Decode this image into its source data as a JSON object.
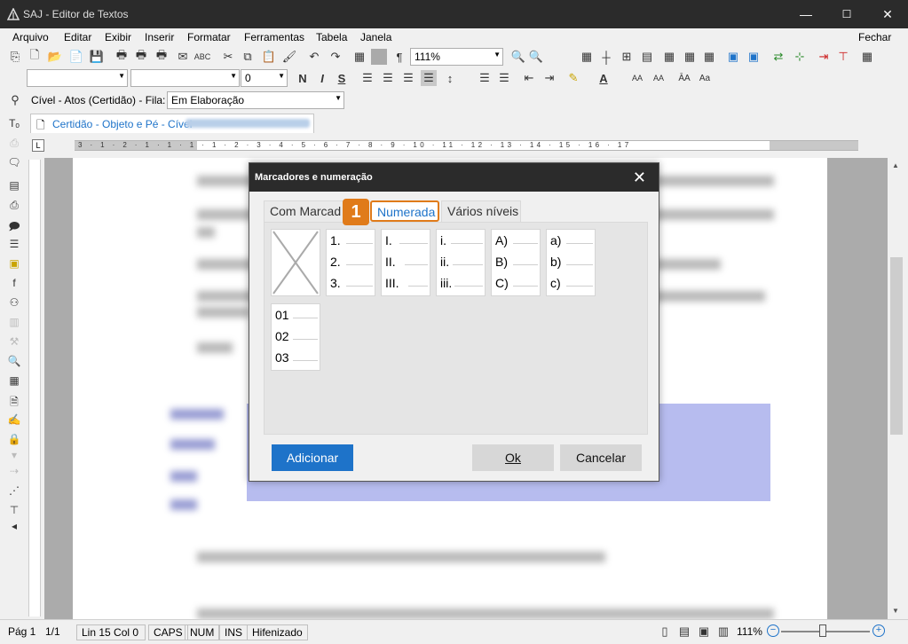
{
  "window": {
    "title": "SAJ - Editor de Textos",
    "min_glyph": "—",
    "max_glyph": "☐",
    "close_glyph": "✕"
  },
  "menu": {
    "items": [
      "Arquivo",
      "Editar",
      "Exibir",
      "Inserir",
      "Formatar",
      "Ferramentas",
      "Tabela",
      "Janela"
    ],
    "close_label": "Fechar"
  },
  "toolbar": {
    "zoom_value": "111%",
    "font_name": "",
    "font_size": "",
    "spacing_value": "0",
    "bold": "N",
    "italic": "I",
    "underline": "S"
  },
  "filter_bar": {
    "label": "Cível - Atos (Certidão) - Fila:",
    "queue_value": "Em Elaboração"
  },
  "document_tab": {
    "label": "Certidão - Objeto e Pé - Cível"
  },
  "ruler": {
    "ticks": "3 · 1 · 2 · 1 · 1 · 1 · 1 · 2 · 3 · 4 · 5 · 6 · 7 · 8 · 9 · 10 · 11 · 12 · 13 · 14 · 15 · 16 · 17"
  },
  "dialog": {
    "title": "Marcadores e numeração",
    "close_glyph": "✕",
    "badge": "1",
    "tabs": [
      "Com Marcad",
      "Numerada",
      "Vários níveis"
    ],
    "active_tab": "Numerada",
    "styles": [
      {
        "name": "none",
        "rows": []
      },
      {
        "name": "arabic",
        "rows": [
          "1.",
          "2.",
          "3."
        ]
      },
      {
        "name": "roman-upper",
        "rows": [
          "I.",
          "II.",
          "III."
        ]
      },
      {
        "name": "roman-lower",
        "rows": [
          "i.",
          "ii.",
          "iii."
        ]
      },
      {
        "name": "alpha-upper",
        "rows": [
          "A)",
          "B)",
          "C)"
        ]
      },
      {
        "name": "alpha-lower",
        "rows": [
          "a)",
          "b)",
          "c)"
        ]
      },
      {
        "name": "zero-padded",
        "rows": [
          "01",
          "02",
          "03"
        ]
      }
    ],
    "buttons": {
      "add": "Adicionar",
      "ok": "Ok",
      "cancel": "Cancelar"
    }
  },
  "statusbar": {
    "page_label": "Pág 1",
    "page_count": "1/1",
    "position": "Lin 15  Col 0",
    "caps": "CAPS",
    "num": "NUM",
    "ins": "INS",
    "hyphen": "Hifenizado",
    "zoom": "111%"
  },
  "colors": {
    "accent": "#1e73c9",
    "highlight_orange": "#e07b1a",
    "title_bar": "#2b2b2b",
    "selection": "#b7bcef"
  }
}
